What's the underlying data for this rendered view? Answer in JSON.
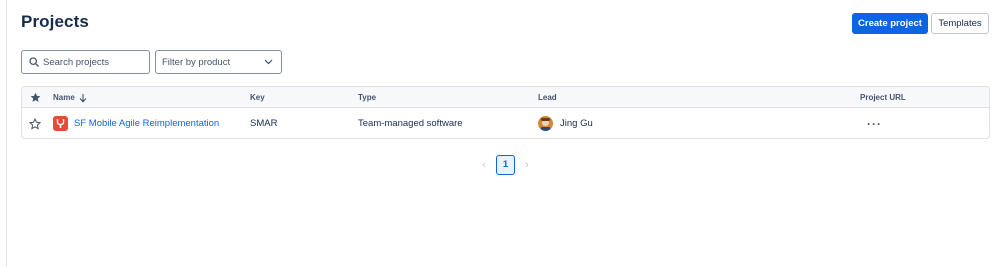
{
  "header": {
    "title": "Projects",
    "create_label": "Create project",
    "templates_label": "Templates"
  },
  "filters": {
    "search_placeholder": "Search projects",
    "product_label": "Filter by product"
  },
  "table": {
    "columns": {
      "name": "Name",
      "key": "Key",
      "type": "Type",
      "lead": "Lead",
      "url": "Project URL"
    },
    "rows": [
      {
        "name": "SF Mobile Agile Reimplementation",
        "key": "SMAR",
        "type": "Team-managed software",
        "lead": "Jing Gu",
        "starred": false
      }
    ]
  },
  "pagination": {
    "current_page": "1",
    "prev_icon": "chevron-left-icon",
    "next_icon": "chevron-right-icon"
  },
  "colors": {
    "primary": "#0c66e4",
    "project_icon": "#e5493a",
    "text": "#172b4d"
  }
}
